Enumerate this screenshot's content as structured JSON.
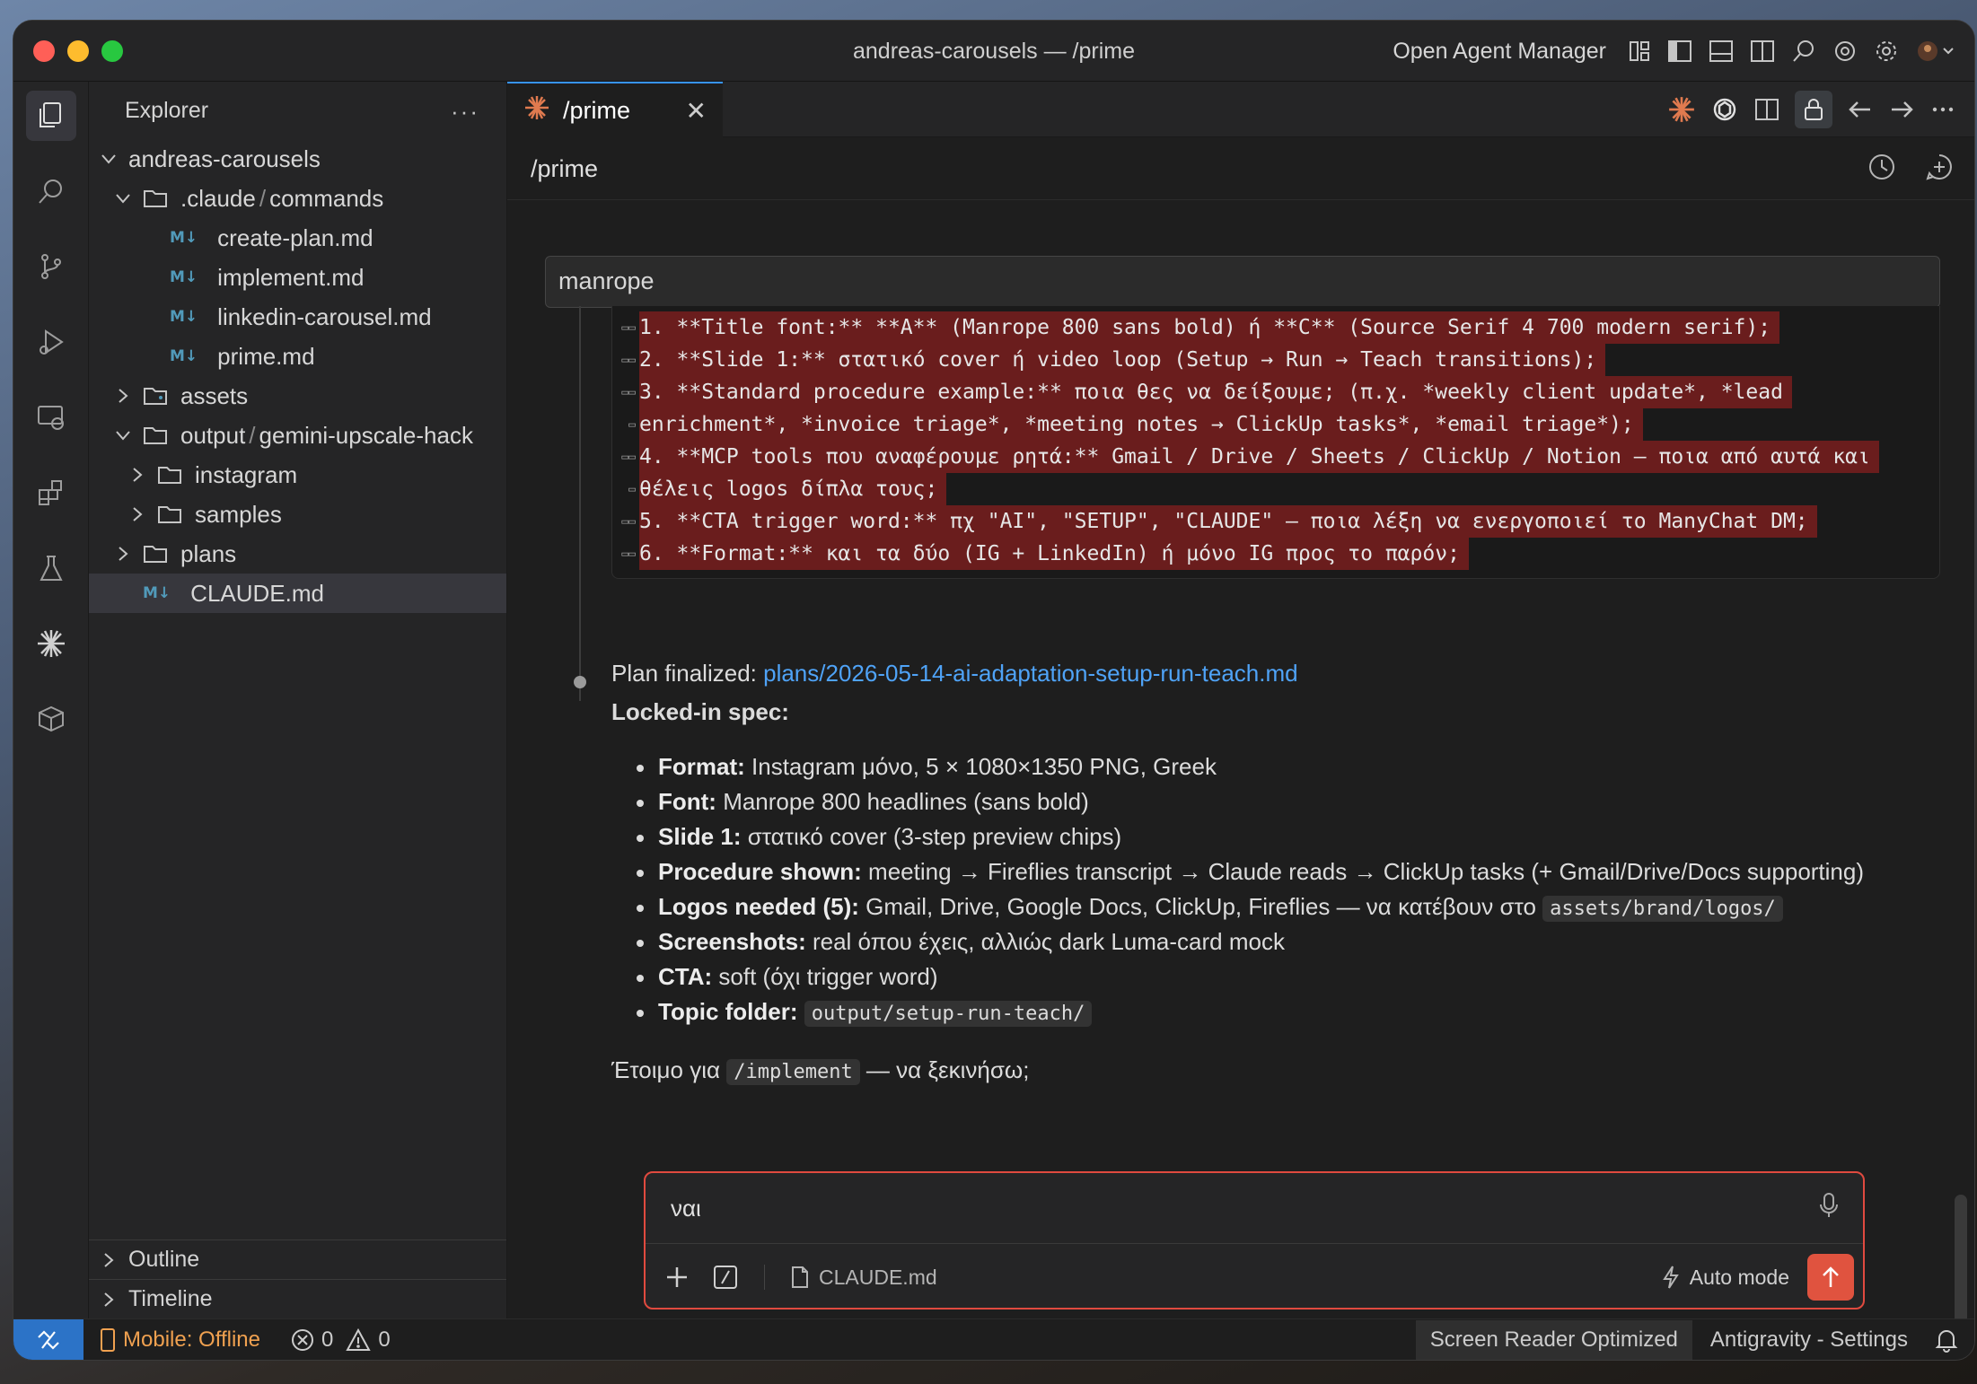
{
  "window": {
    "title": "andreas-carousels — /prime",
    "open_agent_manager": "Open Agent Manager"
  },
  "explorer": {
    "header": "Explorer",
    "more": "···",
    "root": "andreas-carousels",
    "claude_folder_a": ".claude",
    "claude_folder_sep": "/",
    "claude_folder_b": "commands",
    "files_commands": [
      "create-plan.md",
      "implement.md",
      "linkedin-carousel.md",
      "prime.md"
    ],
    "assets": "assets",
    "output_a": "output",
    "output_sep": "/",
    "output_b": "gemini-upscale-hack",
    "instagram": "instagram",
    "samples": "samples",
    "plans": "plans",
    "claude_md": "CLAUDE.md",
    "md_badge": "M↓",
    "outline": "Outline",
    "timeline": "Timeline"
  },
  "tab": {
    "label": "/prime",
    "close": "✕"
  },
  "panel": {
    "title": "/prime",
    "search_value": "manrope"
  },
  "diff_lines": [
    "1. **Title font:** **A** (Manrope 800 sans bold) ή **C** (Source Serif 4 700 modern serif);",
    "2. **Slide 1:** στατικό cover ή video loop (Setup → Run → Teach transitions);",
    "3. **Standard procedure example:** ποια θες να δείξουμε; (π.χ. *weekly client update*, *lead",
    "enrichment*, *invoice triage*, *meeting notes → ClickUp tasks*, *email triage*);",
    "4. **MCP tools που αναφέρουμε ρητά:** Gmail / Drive / Sheets / ClickUp / Notion — ποια από αυτά και",
    "θέλεις logos δίπλα τους;",
    "5. **CTA trigger word:** πχ \"AI\", \"SETUP\", \"CLAUDE\" — ποια λέξη να ενεργοποιεί το ManyChat DM;",
    "6. **Format:** και τα δύο (IG + LinkedIn) ή μόνο IG προς το παρόν;",
    ""
  ],
  "message": {
    "plan_prefix": "Plan finalized: ",
    "plan_link": "plans/2026-05-14-ai-adaptation-setup-run-teach.md",
    "spec_title": "Locked-in spec:",
    "items": [
      {
        "label": "Format:",
        "text": " Instagram μόνο, 5 × 1080×1350 PNG, Greek"
      },
      {
        "label": "Font:",
        "text": " Manrope 800 headlines (sans bold)"
      },
      {
        "label": "Slide 1:",
        "text": " στατικό cover (3-step preview chips)"
      },
      {
        "label": "Procedure shown:",
        "text": " meeting → Fireflies transcript → Claude reads → ClickUp tasks (+ Gmail/Drive/Docs supporting)"
      },
      {
        "label": "Logos needed (5):",
        "text": " Gmail, Drive, Google Docs, ClickUp, Fireflies — να κατέβουν στο ",
        "code": "assets/brand/logos/"
      },
      {
        "label": "Screenshots:",
        "text": " real όπου έχεις, αλλιώς dark Luma-card mock"
      },
      {
        "label": "CTA:",
        "text": " soft (όχι trigger word)"
      },
      {
        "label": "Topic folder:",
        "text": " ",
        "code": "output/setup-run-teach/"
      }
    ],
    "ready_prefix": "Έτοιμο για ",
    "ready_code": "/implement",
    "ready_suffix": " — να ξεκινήσω;"
  },
  "composer": {
    "input_value": "ναι",
    "context_file": "CLAUDE.md",
    "auto_mode": "Auto mode"
  },
  "statusbar": {
    "mobile": "Mobile: Offline",
    "errors": "0",
    "warnings": "0",
    "screen_reader": "Screen Reader Optimized",
    "antigravity": "Antigravity - Settings"
  },
  "colors": {
    "accent": "#3794ff",
    "diff_removed": "#6a1d1d",
    "send": "#e0533f",
    "link": "#4fa3f7",
    "remote": "#2c73c7"
  }
}
